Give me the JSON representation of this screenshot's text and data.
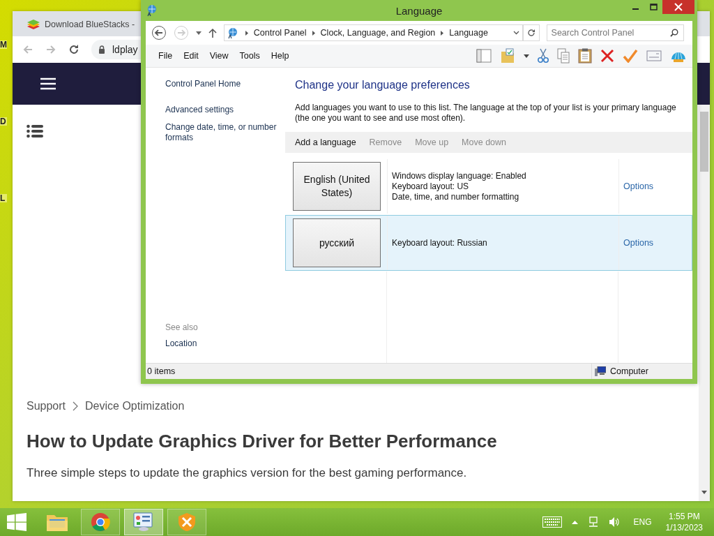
{
  "desktop_icons": [
    {
      "label": "M"
    },
    {
      "label": "D"
    },
    {
      "label": "L"
    }
  ],
  "browser": {
    "tab_title": "Download BlueStacks -",
    "url": "ldplay",
    "breadcrumb": [
      "Support",
      "Device Optimization"
    ],
    "heading": "How to Update Graphics Driver for Better Performance",
    "subheading": "Three simple steps to update the graphics version for the best gaming performance."
  },
  "window": {
    "title": "Language",
    "breadcrumb": [
      "Control Panel",
      "Clock, Language, and Region",
      "Language"
    ],
    "search": {
      "placeholder": "Search Control Panel"
    },
    "menu": [
      "File",
      "Edit",
      "View",
      "Tools",
      "Help"
    ],
    "sidebar": {
      "links": [
        "Control Panel Home",
        "Advanced settings",
        "Change date, time, or number formats"
      ],
      "see_also": "See also",
      "see_also_links": [
        "Location"
      ]
    },
    "heading": "Change your language preferences",
    "description": "Add languages you want to use to this list. The language at the top of your list is your primary language (the one you want to see and use most often).",
    "toolbar": [
      {
        "label": "Add a language",
        "disabled": false
      },
      {
        "label": "Remove",
        "disabled": true
      },
      {
        "label": "Move up",
        "disabled": true
      },
      {
        "label": "Move down",
        "disabled": true
      }
    ],
    "languages": [
      {
        "name": "English (United States)",
        "details": [
          "Windows display language: Enabled",
          "Keyboard layout: US",
          "Date, time, and number formatting"
        ],
        "options": "Options",
        "selected": false
      },
      {
        "name": "русский",
        "details": [
          "Keyboard layout: Russian"
        ],
        "options": "Options",
        "selected": true
      }
    ],
    "status": {
      "items": "0 items",
      "location": "Computer"
    }
  },
  "taskbar": {
    "apps": [
      {
        "kind": "explorer",
        "running": false,
        "selected": false
      },
      {
        "kind": "chrome",
        "running": true,
        "selected": false
      },
      {
        "kind": "control-panel",
        "running": true,
        "selected": true
      },
      {
        "kind": "tools",
        "running": true,
        "selected": false
      }
    ],
    "language": "ENG",
    "time": "1:55 PM",
    "date": "1/13/2023"
  }
}
